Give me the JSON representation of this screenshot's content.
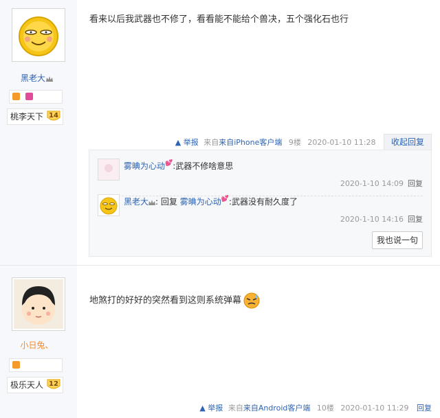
{
  "post1": {
    "username": "黑老大",
    "level_title": "桃李天下",
    "level_num": "14",
    "content": "看来以后我武器也不修了，看看能不能给个兽决，五个强化石也行",
    "tail": {
      "report": "举报",
      "client": "来自iPhone客户端",
      "floor": "9楼",
      "time": "2020-01-10 11:28",
      "reply_toggle": "收起回复"
    },
    "replies": [
      {
        "name": "雾晪为心动",
        "text": ":武器不修啥意思",
        "time": "2020-1-10 14:09",
        "reply": "回复"
      },
      {
        "name": "黑老大",
        "reply_word": "回复",
        "target": "雾晪为心动",
        "text": ":武器没有耐久度了",
        "time": "2020-1-10 14:16",
        "reply": "回复"
      }
    ],
    "say_one": "我也说一句"
  },
  "post2": {
    "username": "小日兔、",
    "level_title": "极乐天人",
    "level_num": "12",
    "content": "地煞打的好好的突然看到这则系统弹幕",
    "tail": {
      "report": "举报",
      "client": "来自Android客户端",
      "floor": "10楼",
      "time": "2020-01-10 11:29",
      "reply": "回复"
    }
  },
  "colors": {
    "link": "#2d64b3",
    "username2": "#f08a2e",
    "meta": "#999999",
    "sidebar": "#f7f8fb"
  }
}
